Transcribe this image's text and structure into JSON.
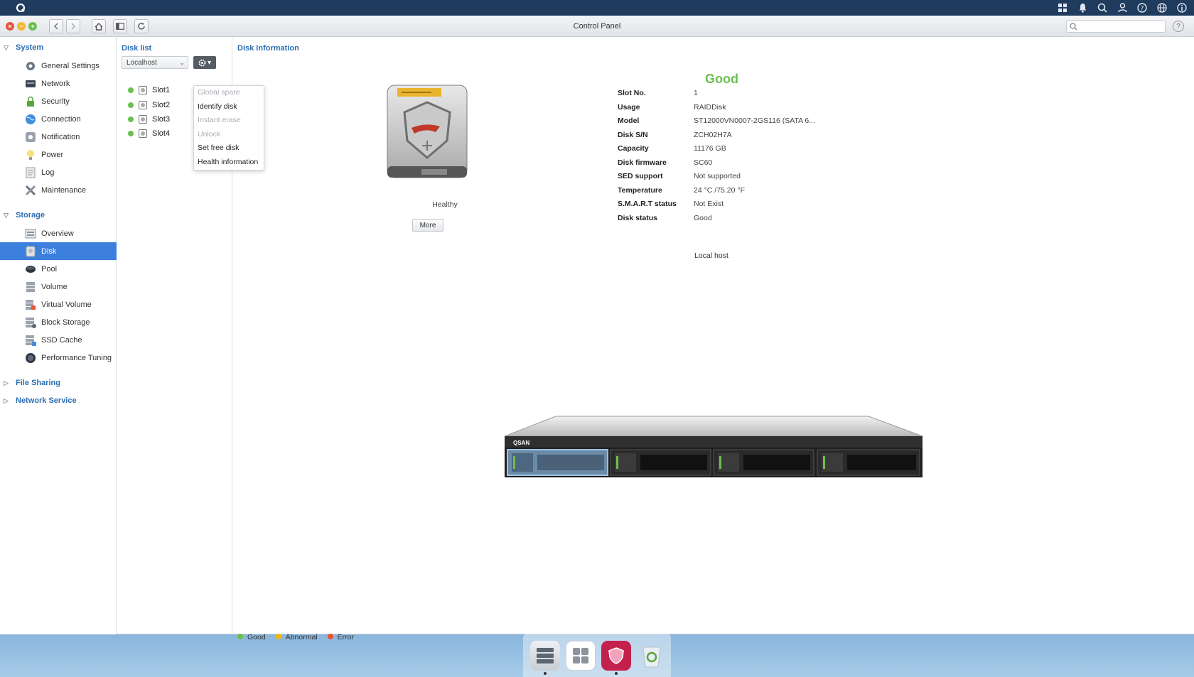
{
  "window": {
    "title": "Control Panel",
    "search_placeholder": ""
  },
  "sidebar": {
    "sections": [
      {
        "label": "System",
        "items": [
          "General Settings",
          "Network",
          "Security",
          "Connection",
          "Notification",
          "Power",
          "Log",
          "Maintenance"
        ]
      },
      {
        "label": "Storage",
        "items": [
          "Overview",
          "Disk",
          "Pool",
          "Volume",
          "Virtual Volume",
          "Block Storage",
          "SSD Cache",
          "Performance Tuning"
        ]
      },
      {
        "label": "File Sharing",
        "items": []
      },
      {
        "label": "Network Service",
        "items": []
      }
    ],
    "active_item": "Disk"
  },
  "disk_list": {
    "title": "Disk list",
    "host_selected": "Localhost",
    "slots": [
      "Slot1",
      "Slot2",
      "Slot3",
      "Slot4"
    ]
  },
  "menu": {
    "items": [
      {
        "label": "Global spare",
        "enabled": false
      },
      {
        "label": "Identify disk",
        "enabled": true
      },
      {
        "label": "Instant erase",
        "enabled": false
      },
      {
        "label": "Unlock",
        "enabled": false
      },
      {
        "label": "Set free disk",
        "enabled": true
      },
      {
        "label": "Health information",
        "enabled": true
      }
    ]
  },
  "disk_info": {
    "title": "Disk Information",
    "status": "Good",
    "health_label": "Healthy",
    "more_label": "More",
    "fields": [
      {
        "label": "Slot No.",
        "value": "1"
      },
      {
        "label": "Usage",
        "value": "RAIDDisk"
      },
      {
        "label": "Model",
        "value": "ST12000VN0007-2GS116 (SATA 6..."
      },
      {
        "label": "Disk S/N",
        "value": "ZCH02H7A"
      },
      {
        "label": "Capacity",
        "value": "11176 GB"
      },
      {
        "label": "Disk firmware",
        "value": "SC60"
      },
      {
        "label": "SED support",
        "value": "Not supported"
      },
      {
        "label": "Temperature",
        "value": "24 °C /75.20 °F"
      },
      {
        "label": "S.M.A.R.T status",
        "value": "Not Exist"
      },
      {
        "label": "Disk status",
        "value": "Good"
      }
    ],
    "host_label": "Local host",
    "enclosure_brand": "QSAN"
  },
  "legend": [
    {
      "label": "Good",
      "color": "#6bbf4e"
    },
    {
      "label": "Abnormal",
      "color": "#f2b705"
    },
    {
      "label": "Error",
      "color": "#e8542f"
    }
  ],
  "colors": {
    "accent": "#2b6db3",
    "active_bg": "#3d7fdc",
    "good": "#6bbf4e"
  }
}
